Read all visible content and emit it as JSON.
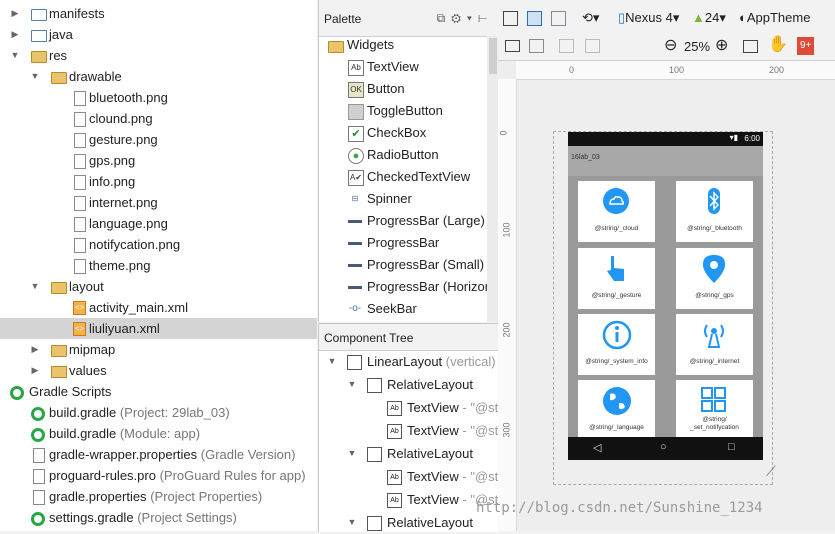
{
  "project_tree": {
    "items": [
      {
        "label": "manifests",
        "sub": ""
      },
      {
        "label": "java",
        "sub": ""
      },
      {
        "label": "res",
        "sub": ""
      },
      {
        "label": "drawable",
        "sub": ""
      },
      {
        "label": "bluetooth.png",
        "sub": ""
      },
      {
        "label": "clound.png",
        "sub": ""
      },
      {
        "label": "gesture.png",
        "sub": ""
      },
      {
        "label": "gps.png",
        "sub": ""
      },
      {
        "label": "info.png",
        "sub": ""
      },
      {
        "label": "internet.png",
        "sub": ""
      },
      {
        "label": "language.png",
        "sub": ""
      },
      {
        "label": "notifycation.png",
        "sub": ""
      },
      {
        "label": "theme.png",
        "sub": ""
      },
      {
        "label": "layout",
        "sub": ""
      },
      {
        "label": "activity_main.xml",
        "sub": ""
      },
      {
        "label": "liuliyuan.xml",
        "sub": ""
      },
      {
        "label": "mipmap",
        "sub": ""
      },
      {
        "label": "values",
        "sub": ""
      },
      {
        "label": "Gradle Scripts",
        "sub": ""
      },
      {
        "label": "build.gradle",
        "sub": "(Project: 29lab_03)"
      },
      {
        "label": "build.gradle",
        "sub": "(Module: app)"
      },
      {
        "label": "gradle-wrapper.properties",
        "sub": "(Gradle Version)"
      },
      {
        "label": "proguard-rules.pro",
        "sub": "(ProGuard Rules for app)"
      },
      {
        "label": "gradle.properties",
        "sub": "(Project Properties)"
      },
      {
        "label": "settings.gradle",
        "sub": "(Project Settings)"
      }
    ]
  },
  "palette": {
    "title": "Palette",
    "group": "Widgets",
    "items": [
      {
        "label": "TextView",
        "icon": "Ab"
      },
      {
        "label": "Button",
        "icon": "OK"
      },
      {
        "label": "ToggleButton",
        "icon": ""
      },
      {
        "label": "CheckBox",
        "icon": "✔"
      },
      {
        "label": "RadioButton",
        "icon": "●"
      },
      {
        "label": "CheckedTextView",
        "icon": "A✔"
      },
      {
        "label": "Spinner",
        "icon": ""
      },
      {
        "label": "ProgressBar (Large)",
        "icon": ""
      },
      {
        "label": "ProgressBar",
        "icon": ""
      },
      {
        "label": "ProgressBar (Small)",
        "icon": ""
      },
      {
        "label": "ProgressBar (Horizont",
        "icon": ""
      },
      {
        "label": "SeekBar",
        "icon": ""
      }
    ]
  },
  "component_tree": {
    "title": "Component Tree",
    "rows": [
      {
        "label": "LinearLayout",
        "sub": "(vertical)"
      },
      {
        "label": "RelativeLayout",
        "sub": ""
      },
      {
        "label": "TextView",
        "sub": "- \"@st"
      },
      {
        "label": "TextView",
        "sub": "- \"@st"
      },
      {
        "label": "RelativeLayout",
        "sub": ""
      },
      {
        "label": "TextView",
        "sub": "- \"@st"
      },
      {
        "label": "TextView",
        "sub": "- \"@st"
      },
      {
        "label": "RelativeLayout",
        "sub": ""
      }
    ]
  },
  "toolbar": {
    "device": "Nexus 4",
    "api": "24",
    "theme": "AppTheme",
    "zoom": "25%",
    "gplus": "9+"
  },
  "rulers": {
    "h": [
      "0",
      "100",
      "200"
    ],
    "v": [
      "0",
      "100",
      "200",
      "300"
    ]
  },
  "phone": {
    "time": "6:00",
    "app_title": "16lab_03",
    "tiles": [
      {
        "label": "@string/_cloud",
        "icon": "cloud-icon"
      },
      {
        "label": "@string/_bluetooth",
        "icon": "bluetooth-icon"
      },
      {
        "label": "@string/_gesture",
        "icon": "hand-pointer-icon"
      },
      {
        "label": "@string/_gps",
        "icon": "gps-pin-icon"
      },
      {
        "label": "@string/_system_info",
        "icon": "info-icon"
      },
      {
        "label": "@string/_internet",
        "icon": "antenna-icon"
      },
      {
        "label": "@string/_language",
        "icon": "globe-icon"
      },
      {
        "label": "@string/\n_set_notifycation",
        "icon": "grid-icon"
      }
    ],
    "accent": "#2196f3"
  },
  "watermark": "http://blog.csdn.net/Sunshine_1234"
}
